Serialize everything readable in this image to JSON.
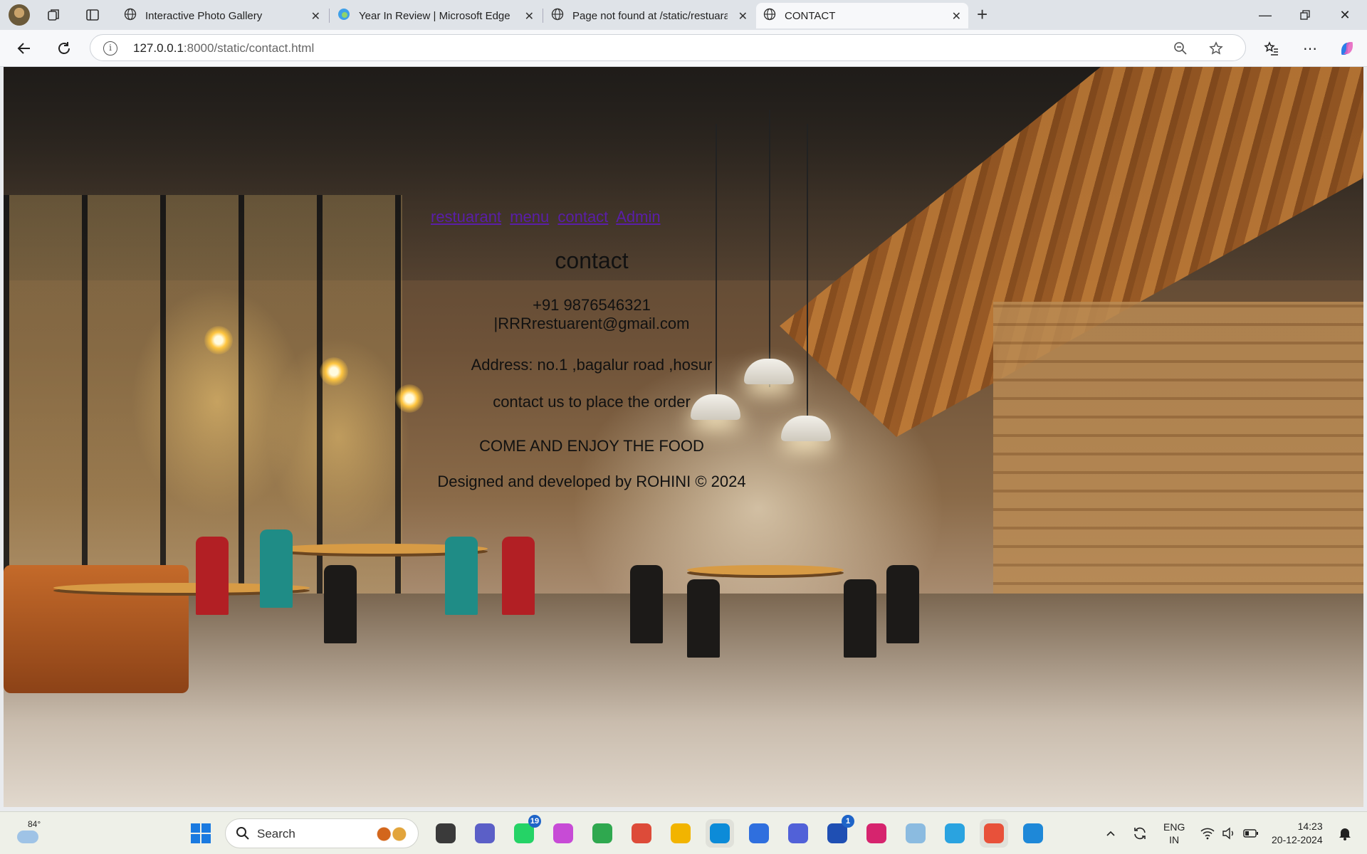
{
  "browser": {
    "tabs": [
      {
        "title": "Interactive Photo Gallery",
        "icon": "globe-icon",
        "active": false
      },
      {
        "title": "Year In Review | Microsoft Edge",
        "icon": "edge-icon",
        "active": false
      },
      {
        "title": "Page not found at /static/restuarant",
        "icon": "globe-icon",
        "active": false
      },
      {
        "title": "CONTACT",
        "icon": "globe-icon",
        "active": true
      }
    ],
    "url_host": "127.0.0.1",
    "url_path": ":8000/static/contact.html"
  },
  "page": {
    "nav_links": [
      "restuarant",
      "menu",
      "contact",
      "Admin"
    ],
    "heading": "contact",
    "phone": "+91 9876546321",
    "email": "|RRRrestuarent@gmail.com",
    "address": "Address: no.1 ,bagalur road ,hosur",
    "order_note": "contact us to place the order",
    "tagline": "COME AND ENJOY THE FOOD",
    "footer": "Designed and developed by ROHINI © 2024"
  },
  "taskbar": {
    "weather_temp": "84°",
    "search_placeholder": "Search",
    "apps": [
      {
        "name": "file-manager-icon",
        "color": "#3a3a3a",
        "badge": ""
      },
      {
        "name": "teams-icon",
        "color": "#5b5fc7",
        "badge": ""
      },
      {
        "name": "whatsapp-icon",
        "color": "#25d366",
        "badge": "19"
      },
      {
        "name": "copilot-icon",
        "color": "#c74bd6",
        "badge": ""
      },
      {
        "name": "refresh-app-icon",
        "color": "#2fa84f",
        "badge": ""
      },
      {
        "name": "chrome-icon",
        "color": "#dd4b39",
        "badge": ""
      },
      {
        "name": "file-explorer-icon",
        "color": "#f2b400",
        "badge": ""
      },
      {
        "name": "edge-icon",
        "color": "#0c8bd8",
        "badge": ""
      },
      {
        "name": "store-icon",
        "color": "#2f6fde",
        "badge": ""
      },
      {
        "name": "vector-app-icon",
        "color": "#5161d8",
        "badge": ""
      },
      {
        "name": "lens-icon",
        "color": "#1f4fb3",
        "badge": "1"
      },
      {
        "name": "instagram-icon",
        "color": "#d6246e",
        "badge": ""
      },
      {
        "name": "canva-icon",
        "color": "#8bbbe0",
        "badge": ""
      },
      {
        "name": "telegram-icon",
        "color": "#2aa3e0",
        "badge": ""
      },
      {
        "name": "paint-icon",
        "color": "#e8513a",
        "badge": ""
      },
      {
        "name": "vscode-icon",
        "color": "#1e88d8",
        "badge": ""
      }
    ],
    "lang_top": "ENG",
    "lang_bottom": "IN",
    "time": "14:23",
    "date": "20-12-2024"
  }
}
